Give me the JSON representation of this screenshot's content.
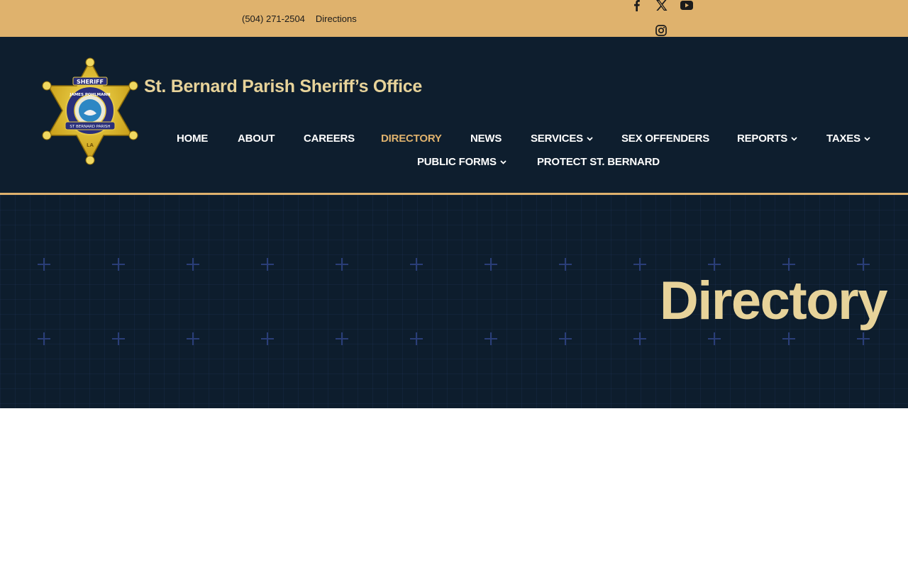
{
  "topbar": {
    "phone": "(504) 271-2504",
    "directions": "Directions",
    "social": [
      "facebook-icon",
      "x-icon",
      "youtube-icon",
      "instagram-icon"
    ]
  },
  "header": {
    "site_title": "St. Bernard Parish Sheriff’s Office",
    "logo_text": {
      "top": "SHERIFF",
      "name": "JAMES POHLMANN",
      "parish": "ST BERNARD PARISH",
      "bottom": "LA"
    }
  },
  "nav": {
    "home": "HOME",
    "about": "ABOUT",
    "careers": "CAREERS",
    "directory": "DIRECTORY",
    "news": "NEWS",
    "services": "SERVICES",
    "sex_offenders": "SEX OFFENDERS",
    "reports": "REPORTS",
    "taxes": "TAXES",
    "public_forms": "PUBLIC FORMS",
    "protect": "PROTECT ST. BERNARD",
    "active": "DIRECTORY"
  },
  "hero": {
    "title": "Directory"
  },
  "colors": {
    "gold": "#dfb26d",
    "navy": "#0e1e2e",
    "title_cream": "#e7d39a"
  }
}
